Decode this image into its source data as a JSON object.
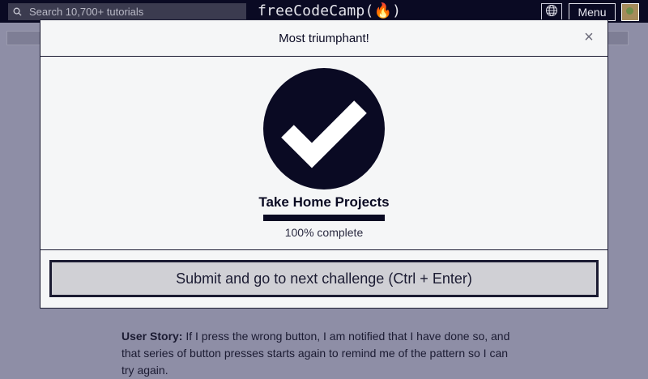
{
  "nav": {
    "search_placeholder": "Search 10,700+ tutorials",
    "brand": "freeCodeCamp(🔥)",
    "menu_label": "Menu"
  },
  "background": {
    "story_label": "User Story:",
    "story_text": " If I press the wrong button, I am notified that I have done so, and that series of button presses starts again to remind me of the pattern so I can try again."
  },
  "modal": {
    "title": "Most triumphant!",
    "close_label": "×",
    "block_title": "Take Home Projects",
    "progress_percent": 100,
    "progress_text": "100% complete",
    "submit_label": "Submit and go to next challenge (Ctrl + Enter)"
  },
  "colors": {
    "nav_bg": "#0a0a23",
    "modal_bg": "#f5f6f7",
    "check_circle": "#0a0a23",
    "overlay": "#8e8ea6"
  },
  "icons": {
    "search": "search-icon",
    "globe": "globe-icon",
    "close": "close-icon",
    "check": "checkmark-icon"
  }
}
